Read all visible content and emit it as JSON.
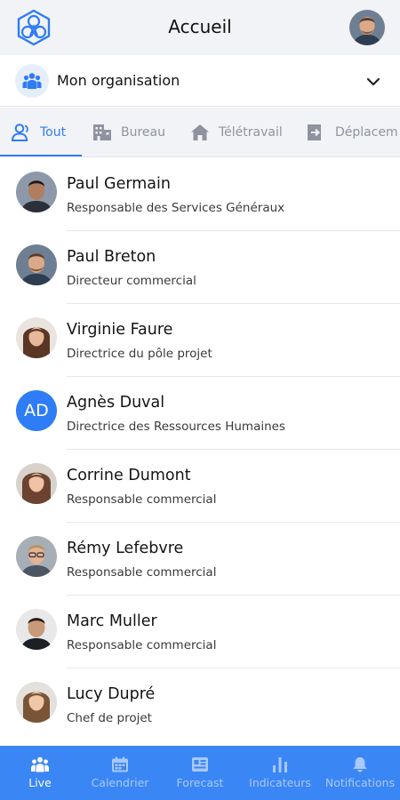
{
  "header": {
    "title": "Accueil",
    "logo_icon": "app-logo-icon",
    "avatar_icon": "user-avatar"
  },
  "organization": {
    "label": "Mon organisation",
    "icon": "people-icon",
    "chevron_icon": "chevron-down-icon"
  },
  "tabs": [
    {
      "label": "Tout",
      "icon": "user-icon",
      "active": true
    },
    {
      "label": "Bureau",
      "icon": "building-icon",
      "active": false
    },
    {
      "label": "Télétravail",
      "icon": "home-icon",
      "active": false
    },
    {
      "label": "Déplacem",
      "icon": "exit-icon",
      "active": false
    }
  ],
  "people": [
    {
      "name": "Paul Germain",
      "role": "Responsable des Services Généraux"
    },
    {
      "name": "Paul Breton",
      "role": "Directeur commercial"
    },
    {
      "name": "Virginie Faure",
      "role": "Directrice du pôle projet"
    },
    {
      "name": "Agnès Duval",
      "role": "Directrice des Ressources Humaines",
      "initials": "AD"
    },
    {
      "name": "Corrine Dumont",
      "role": "Responsable commercial"
    },
    {
      "name": "Rémy Lefebvre",
      "role": "Responsable commercial"
    },
    {
      "name": "Marc Muller",
      "role": "Responsable commercial"
    },
    {
      "name": "Lucy Dupré",
      "role": "Chef de projet"
    }
  ],
  "bottom_nav": [
    {
      "label": "Live",
      "icon": "people-icon",
      "active": true
    },
    {
      "label": "Calendrier",
      "icon": "calendar-icon",
      "active": false
    },
    {
      "label": "Forecast",
      "icon": "forecast-icon",
      "active": false
    },
    {
      "label": "Indicateurs",
      "icon": "bar-chart-icon",
      "active": false
    },
    {
      "label": "Notifications",
      "icon": "bell-icon",
      "active": false
    }
  ],
  "colors": {
    "accent": "#2e7cf6",
    "nav_background": "#3b86f5",
    "header_background": "#f2f3f6"
  }
}
